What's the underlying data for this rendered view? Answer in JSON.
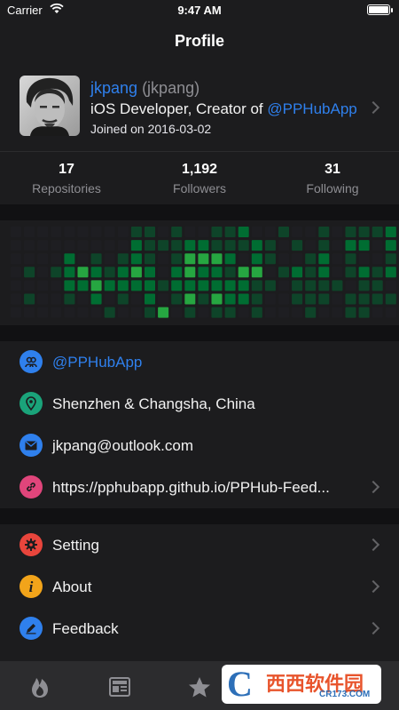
{
  "status_bar": {
    "carrier": "Carrier",
    "time": "9:47 AM"
  },
  "nav": {
    "title": "Profile"
  },
  "profile": {
    "name": "jkpang",
    "login": "(jkpang)",
    "bio_prefix": "iOS Developer, Creator of ",
    "bio_company": "@PPHubApp",
    "joined": "Joined on 2016-03-02"
  },
  "stats": [
    {
      "count": "17",
      "label": "Repositories"
    },
    {
      "count": "1,192",
      "label": "Followers"
    },
    {
      "count": "31",
      "label": "Following"
    }
  ],
  "contributions": {
    "weeks": 29,
    "days": 7,
    "colors": [
      "#1e1e22",
      "#0e4429",
      "#006d32",
      "#26a641",
      "#39d353"
    ],
    "levels": [
      [
        0,
        0,
        0,
        0,
        0,
        0,
        0
      ],
      [
        0,
        0,
        0,
        1,
        0,
        1,
        0
      ],
      [
        0,
        0,
        0,
        0,
        0,
        0,
        0
      ],
      [
        0,
        0,
        0,
        1,
        0,
        0,
        0
      ],
      [
        0,
        0,
        2,
        2,
        2,
        1,
        0
      ],
      [
        0,
        0,
        0,
        3,
        2,
        0,
        0
      ],
      [
        0,
        0,
        1,
        2,
        3,
        2,
        0
      ],
      [
        0,
        0,
        0,
        1,
        2,
        0,
        1
      ],
      [
        0,
        0,
        1,
        2,
        2,
        1,
        0
      ],
      [
        1,
        2,
        2,
        3,
        2,
        0,
        0
      ],
      [
        1,
        1,
        1,
        2,
        2,
        2,
        1
      ],
      [
        0,
        1,
        0,
        0,
        1,
        0,
        3
      ],
      [
        1,
        1,
        1,
        2,
        2,
        1,
        0
      ],
      [
        0,
        2,
        3,
        3,
        2,
        3,
        1
      ],
      [
        0,
        2,
        3,
        2,
        2,
        1,
        0
      ],
      [
        1,
        1,
        3,
        2,
        2,
        3,
        1
      ],
      [
        1,
        1,
        2,
        1,
        2,
        2,
        1
      ],
      [
        2,
        1,
        0,
        3,
        2,
        2,
        0
      ],
      [
        0,
        2,
        2,
        3,
        1,
        1,
        1
      ],
      [
        0,
        1,
        1,
        0,
        1,
        0,
        0
      ],
      [
        1,
        0,
        0,
        1,
        0,
        0,
        0
      ],
      [
        0,
        1,
        0,
        2,
        1,
        1,
        0
      ],
      [
        0,
        0,
        1,
        1,
        1,
        1,
        1
      ],
      [
        1,
        1,
        2,
        2,
        1,
        1,
        0
      ],
      [
        0,
        0,
        0,
        0,
        1,
        0,
        0
      ],
      [
        1,
        2,
        1,
        1,
        0,
        1,
        1
      ],
      [
        1,
        2,
        0,
        2,
        1,
        1,
        1
      ],
      [
        1,
        0,
        0,
        1,
        1,
        1,
        0
      ],
      [
        2,
        2,
        1,
        2,
        0,
        1,
        0
      ]
    ]
  },
  "info_rows": [
    {
      "icon": "organization-icon",
      "color": "#2f80ed",
      "label": "@PPHubApp",
      "is_link": true,
      "chevron": false
    },
    {
      "icon": "location-pin-icon",
      "color": "#1aa37a",
      "label": "Shenzhen & Changsha, China",
      "is_link": false,
      "chevron": false
    },
    {
      "icon": "mail-icon",
      "color": "#2f80ed",
      "label": "jkpang@outlook.com",
      "is_link": false,
      "chevron": false
    },
    {
      "icon": "link-icon",
      "color": "#e0457b",
      "label": "https://pphubapp.github.io/PPHub-Feed...",
      "is_link": false,
      "chevron": true
    }
  ],
  "settings_rows": [
    {
      "icon": "gear-icon",
      "color": "#e8453c",
      "label": "Setting"
    },
    {
      "icon": "info-icon",
      "color": "#f2a41a",
      "label": "About"
    },
    {
      "icon": "pencil-icon",
      "color": "#2f80ed",
      "label": "Feedback"
    }
  ],
  "tabs": [
    {
      "icon": "flame-icon"
    },
    {
      "icon": "news-icon"
    },
    {
      "icon": "star-icon"
    }
  ],
  "watermark": {
    "brand": "西西软件园",
    "url": "CR173.COM"
  },
  "colors": {
    "background": "#1c1c1e",
    "band": "#111113",
    "accent": "#2f80ed",
    "secondary_text": "#8e8e93"
  }
}
